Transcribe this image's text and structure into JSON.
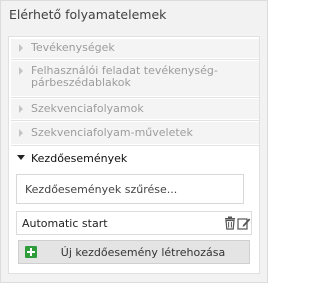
{
  "panel": {
    "title": "Elérhető folyamatelemek"
  },
  "accordion": {
    "collapsed_items": [
      {
        "label": "Tevékenységek"
      },
      {
        "label": "Felhasználói feladat tevékenység-párbeszédablakok"
      },
      {
        "label": "Szekvenciafolyamok"
      },
      {
        "label": "Szekvenciafolyam-műveletek"
      }
    ],
    "open_item": {
      "label": "Kezdőesemények"
    }
  },
  "start_events": {
    "filter_placeholder": "Kezdőesemények szűrése...",
    "items": [
      {
        "label": "Automatic start"
      }
    ],
    "add_button_label": "Új kezdőesemény létrehozása"
  },
  "icons": {
    "collapsed_arrow": "chevron-right-icon",
    "open_arrow": "caret-down-icon",
    "delete": "trash-icon",
    "edit": "edit-icon",
    "add": "plus-square-icon"
  },
  "colors": {
    "add_icon": "#2f9d3c",
    "panel_background": "#f2f2f2",
    "collapsed_text": "#9c9c9c"
  }
}
